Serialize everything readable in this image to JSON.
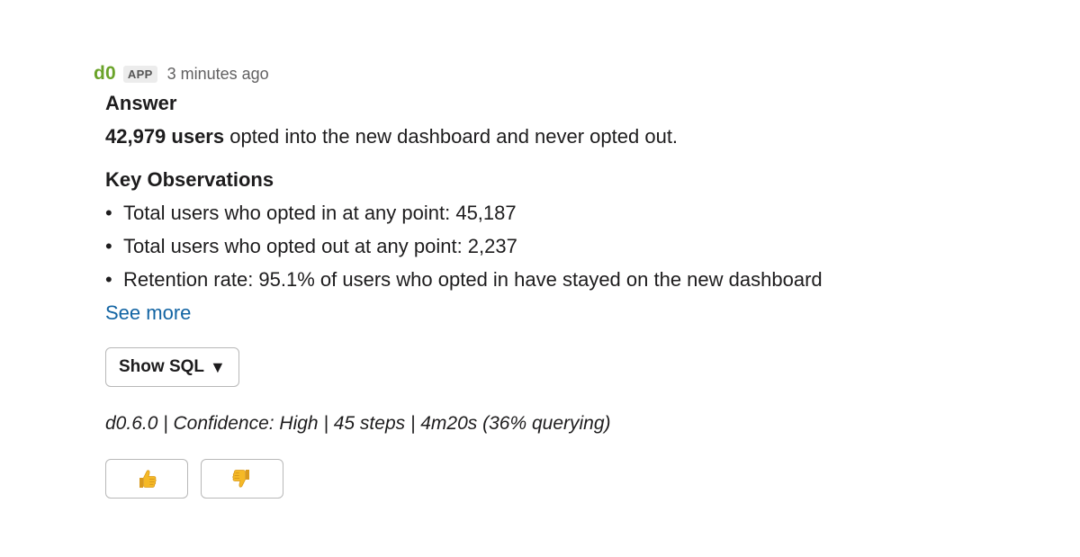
{
  "message": {
    "sender": "d0",
    "badge": "APP",
    "timestamp": "3 minutes ago",
    "answer_heading": "Answer",
    "answer_bold": "42,979 users",
    "answer_rest": " opted into the new dashboard and never opted out.",
    "observations_heading": "Key Observations",
    "bullet_char": "•",
    "observations": [
      "Total users who opted in at any point: 45,187",
      "Total users who opted out at any point: 2,237",
      "Retention rate: 95.1% of users who opted in have stayed on the new dashboard"
    ],
    "see_more": "See more",
    "show_sql": "Show SQL",
    "show_sql_caret": "▼",
    "meta": "d0.6.0 | Confidence: High | 45 steps | 4m20s (36% querying)"
  },
  "colors": {
    "sender": "#6aa329",
    "link": "#1264a3",
    "thumb": "#f5b926"
  },
  "icons": {
    "thumbs_up": "thumbs-up-icon",
    "thumbs_down": "thumbs-down-icon"
  }
}
